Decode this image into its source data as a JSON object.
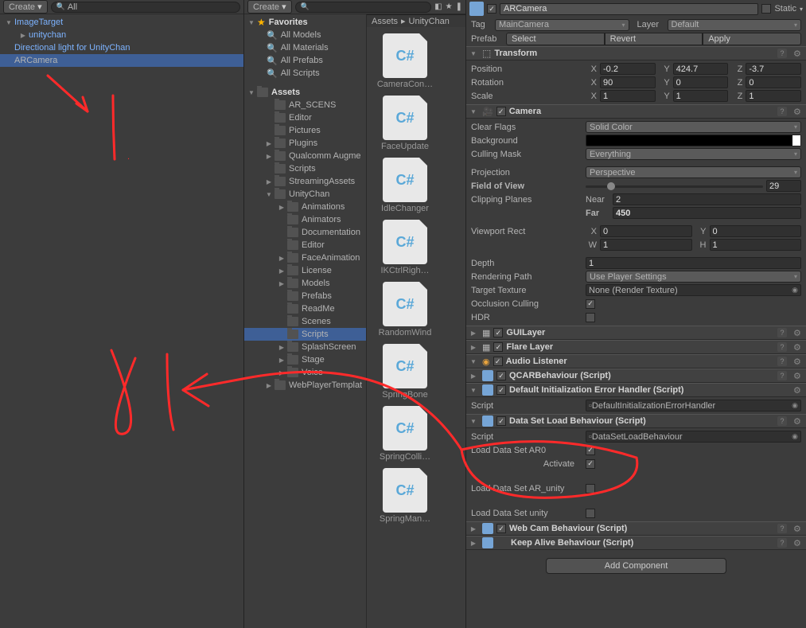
{
  "hierarchy": {
    "create": "Create",
    "search": "All",
    "items": [
      {
        "label": "ImageTarget",
        "depth": 0,
        "expanded": true,
        "link": true
      },
      {
        "label": "unitychan",
        "depth": 1,
        "expanded": false,
        "link": true
      },
      {
        "label": "Directional light for UnityChan",
        "depth": 0,
        "link": true
      },
      {
        "label": "ARCamera",
        "depth": 0,
        "selected": true
      }
    ]
  },
  "project": {
    "create": "Create",
    "breadcrumb": [
      "Assets",
      "UnityChan"
    ],
    "favorites": {
      "label": "Favorites",
      "items": [
        "All Models",
        "All Materials",
        "All Prefabs",
        "All Scripts"
      ]
    },
    "assets_root": "Assets",
    "folders": [
      {
        "label": "AR_SCENS",
        "depth": 1
      },
      {
        "label": "Editor",
        "depth": 1
      },
      {
        "label": "Pictures",
        "depth": 1
      },
      {
        "label": "Plugins",
        "depth": 1,
        "fold": true
      },
      {
        "label": "Qualcomm Augme",
        "depth": 1,
        "fold": true
      },
      {
        "label": "Scripts",
        "depth": 1
      },
      {
        "label": "StreamingAssets",
        "depth": 1,
        "fold": true
      },
      {
        "label": "UnityChan",
        "depth": 1,
        "fold": true,
        "expanded": true
      },
      {
        "label": "Animations",
        "depth": 2,
        "fold": true
      },
      {
        "label": "Animators",
        "depth": 2
      },
      {
        "label": "Documentation",
        "depth": 2
      },
      {
        "label": "Editor",
        "depth": 2
      },
      {
        "label": "FaceAnimation",
        "depth": 2,
        "fold": true
      },
      {
        "label": "License",
        "depth": 2,
        "fold": true
      },
      {
        "label": "Models",
        "depth": 2,
        "fold": true
      },
      {
        "label": "Prefabs",
        "depth": 2
      },
      {
        "label": "ReadMe",
        "depth": 2
      },
      {
        "label": "Scenes",
        "depth": 2
      },
      {
        "label": "Scripts",
        "depth": 2,
        "selected": true
      },
      {
        "label": "SplashScreen",
        "depth": 2,
        "fold": true
      },
      {
        "label": "Stage",
        "depth": 2,
        "fold": true
      },
      {
        "label": "Voice",
        "depth": 2,
        "fold": true
      },
      {
        "label": "WebPlayerTemplat",
        "depth": 1,
        "fold": true
      }
    ],
    "grid": [
      "CameraCon…",
      "FaceUpdate",
      "IdleChanger",
      "IKCtrlRigh…",
      "RandomWind",
      "SpringBone",
      "SpringColli…",
      "SpringMan…"
    ]
  },
  "inspector": {
    "name": "ARCamera",
    "static": "Static",
    "tag_label": "Tag",
    "tag": "MainCamera",
    "layer_label": "Layer",
    "layer": "Default",
    "prefab_label": "Prefab",
    "prefab_btns": [
      "Select",
      "Revert",
      "Apply"
    ],
    "transform": {
      "title": "Transform",
      "position": {
        "label": "Position",
        "x": "-0.2",
        "y": "424.7",
        "z": "-3.7"
      },
      "rotation": {
        "label": "Rotation",
        "x": "90",
        "y": "0",
        "z": "0"
      },
      "scale": {
        "label": "Scale",
        "x": "1",
        "y": "1",
        "z": "1"
      }
    },
    "camera": {
      "title": "Camera",
      "clear_flags": {
        "label": "Clear Flags",
        "value": "Solid Color"
      },
      "background": "Background",
      "culling_mask": {
        "label": "Culling Mask",
        "value": "Everything"
      },
      "projection": {
        "label": "Projection",
        "value": "Perspective"
      },
      "fov": {
        "label": "Field of View",
        "value": "29"
      },
      "clipping": {
        "label": "Clipping Planes",
        "near_label": "Near",
        "near": "2",
        "far_label": "Far",
        "far": "450"
      },
      "viewport": {
        "label": "Viewport Rect",
        "x": "0",
        "y": "0",
        "w": "1",
        "h": "1"
      },
      "depth": {
        "label": "Depth",
        "value": "1"
      },
      "rendering_path": {
        "label": "Rendering Path",
        "value": "Use Player Settings"
      },
      "target_texture": {
        "label": "Target Texture",
        "value": "None (Render Texture)"
      },
      "occlusion": {
        "label": "Occlusion Culling"
      },
      "hdr": {
        "label": "HDR"
      }
    },
    "guilayer": "GUILayer",
    "flare": "Flare Layer",
    "audio": "Audio Listener",
    "qcar": "QCARBehaviour (Script)",
    "dieh": {
      "title": "Default Initialization Error Handler (Script)",
      "script_label": "Script",
      "script": "DefaultInitializationErrorHandler"
    },
    "dslb": {
      "title": "Data Set Load Behaviour (Script)",
      "script_label": "Script",
      "script": "DataSetLoadBehaviour",
      "load_ar0": "Load Data Set AR0",
      "activate": "Activate",
      "load_ar_unity": "Load Data Set AR_unity",
      "load_unity": "Load Data Set unity"
    },
    "webcam": "Web Cam Behaviour (Script)",
    "keepalive": "Keep Alive Behaviour (Script)",
    "add_component": "Add Component"
  }
}
